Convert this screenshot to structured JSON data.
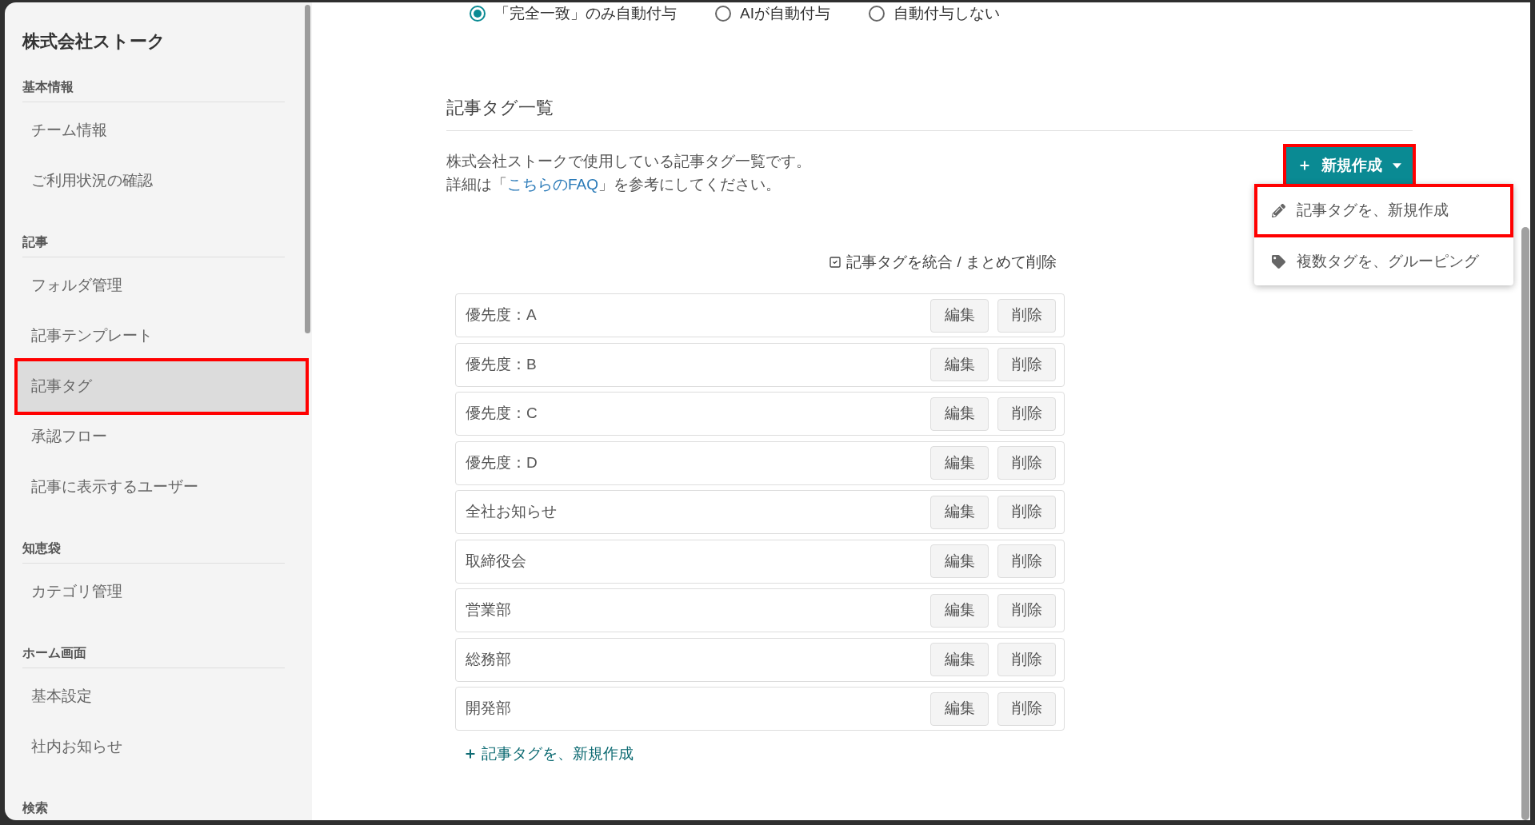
{
  "auto_tag_options": [
    {
      "label": "「完全一致」のみ自動付与",
      "selected": true
    },
    {
      "label": "AIが自動付与",
      "selected": false
    },
    {
      "label": "自動付与しない",
      "selected": false
    }
  ],
  "sidebar": {
    "title": "株式会社ストーク",
    "sections": [
      {
        "heading": "基本情報",
        "items": [
          {
            "label": "チーム情報",
            "selected": false,
            "highlighted": false
          },
          {
            "label": "ご利用状況の確認",
            "selected": false,
            "highlighted": false
          }
        ]
      },
      {
        "heading": "記事",
        "items": [
          {
            "label": "フォルダ管理",
            "selected": false,
            "highlighted": false
          },
          {
            "label": "記事テンプレート",
            "selected": false,
            "highlighted": false
          },
          {
            "label": "記事タグ",
            "selected": true,
            "highlighted": true
          },
          {
            "label": "承認フロー",
            "selected": false,
            "highlighted": false
          },
          {
            "label": "記事に表示するユーザー",
            "selected": false,
            "highlighted": false
          }
        ]
      },
      {
        "heading": "知恵袋",
        "items": [
          {
            "label": "カテゴリ管理",
            "selected": false,
            "highlighted": false
          }
        ]
      },
      {
        "heading": "ホーム画面",
        "items": [
          {
            "label": "基本設定",
            "selected": false,
            "highlighted": false
          },
          {
            "label": "社内お知らせ",
            "selected": false,
            "highlighted": false
          }
        ]
      },
      {
        "heading": "検索"
      }
    ]
  },
  "tag_list": {
    "title": "記事タグ一覧",
    "description": "株式会社ストークで使用している記事タグ一覧です。",
    "help": {
      "before": "詳細は「",
      "link": "こちらのFAQ",
      "after": "」を参考にしてください。"
    },
    "new_button": {
      "label": "新規作成",
      "highlighted": true
    },
    "new_menu": [
      {
        "kind": "create",
        "label": "記事タグを、新規作成",
        "highlighted": true
      },
      {
        "kind": "group",
        "label": "複数タグを、グルーピング",
        "highlighted": false
      }
    ],
    "merge_action": "記事タグを統合 / まとめて削除",
    "tags": [
      {
        "name": "優先度：A",
        "edit": "編集",
        "delete": "削除"
      },
      {
        "name": "優先度：B",
        "edit": "編集",
        "delete": "削除"
      },
      {
        "name": "優先度：C",
        "edit": "編集",
        "delete": "削除"
      },
      {
        "name": "優先度：D",
        "edit": "編集",
        "delete": "削除"
      },
      {
        "name": "全社お知らせ",
        "edit": "編集",
        "delete": "削除"
      },
      {
        "name": "取締役会",
        "edit": "編集",
        "delete": "削除"
      },
      {
        "name": "営業部",
        "edit": "編集",
        "delete": "削除"
      },
      {
        "name": "総務部",
        "edit": "編集",
        "delete": "削除"
      },
      {
        "name": "開発部",
        "edit": "編集",
        "delete": "削除"
      }
    ],
    "add_link": "記事タグを、新規作成"
  }
}
